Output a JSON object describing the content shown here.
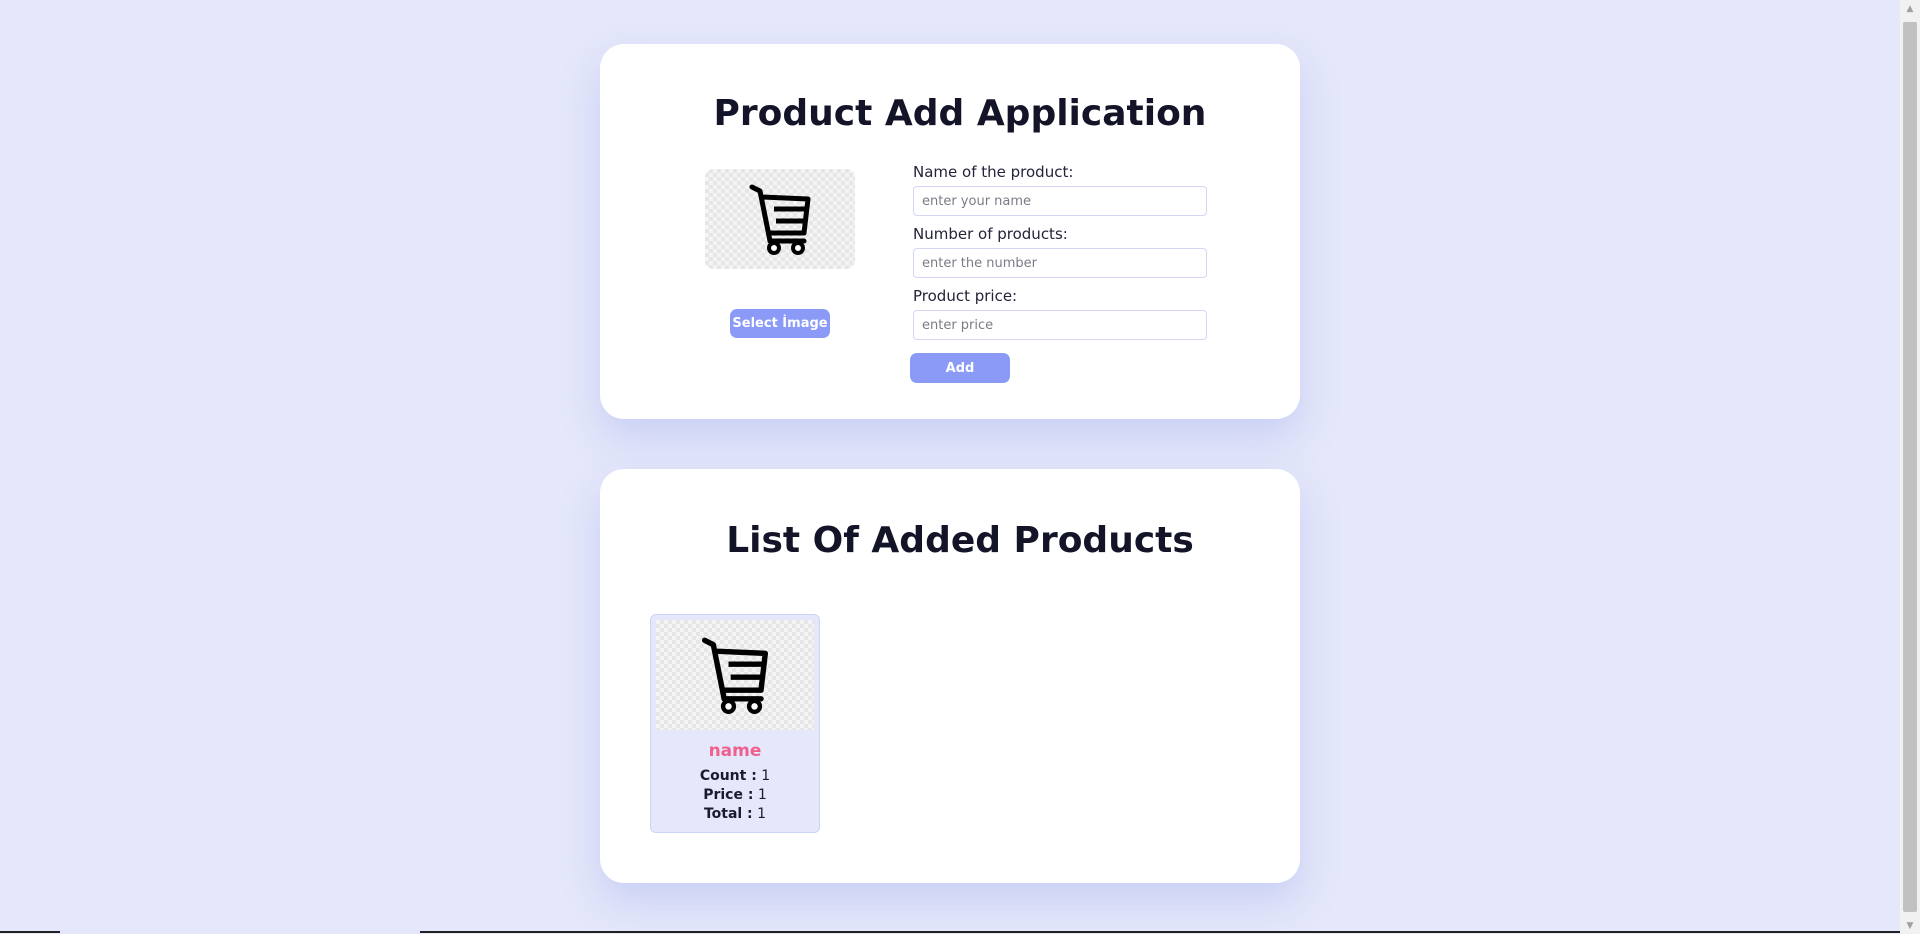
{
  "add_form": {
    "title": "Product Add Application",
    "select_image_label": "Select İmage",
    "name_label": "Name of the product:",
    "name_placeholder": "enter your name",
    "count_label": "Number of products:",
    "count_placeholder": "enter the number",
    "price_label": "Product price:",
    "price_placeholder": "enter price",
    "add_label": "Add",
    "preview_icon": "shopping-cart-icon"
  },
  "product_list": {
    "title": "List Of Added Products",
    "items": [
      {
        "name": "name",
        "count_label": "Count :",
        "count": "1",
        "price_label": "Price :",
        "price": "1",
        "total_label": "Total :",
        "total": "1",
        "icon": "shopping-cart-icon"
      }
    ]
  },
  "colors": {
    "background": "#e5e8fa",
    "button": "#8b9af7",
    "product_name": "#f0608f"
  }
}
